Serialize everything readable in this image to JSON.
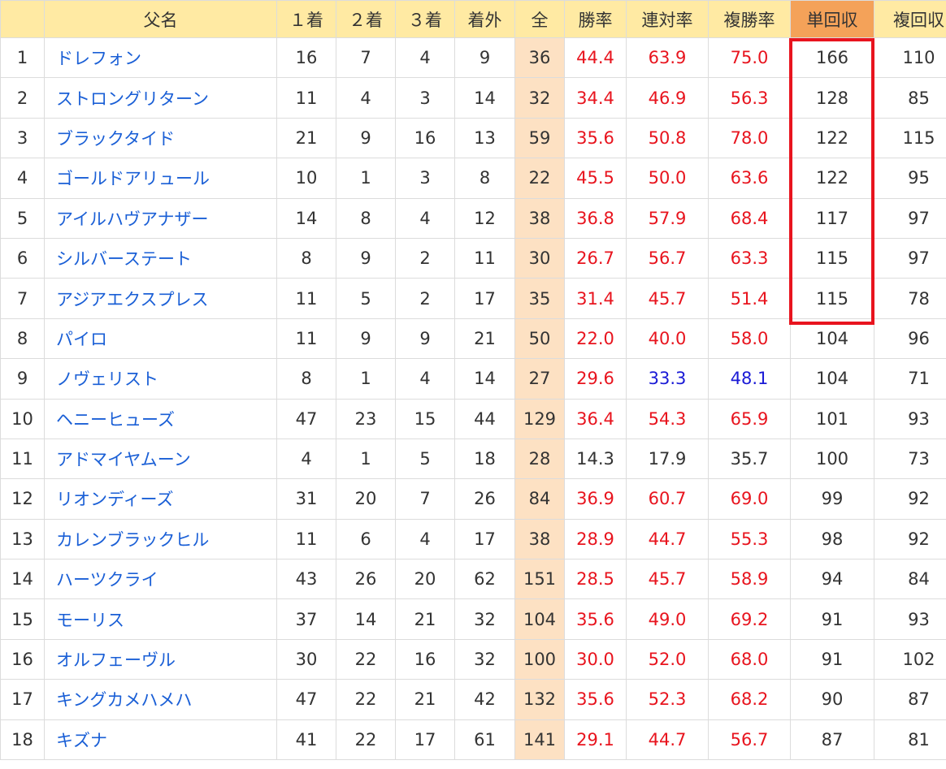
{
  "headers": [
    "",
    "父名",
    "１着",
    "２着",
    "３着",
    "着外",
    "全",
    "勝率",
    "連対率",
    "複勝率",
    "単回収",
    "複回収"
  ],
  "rows": [
    {
      "rank": "1",
      "name": "ドレフォン",
      "w1": "16",
      "w2": "7",
      "w3": "4",
      "out": "9",
      "total": "36",
      "win": "44.4",
      "rentai": "63.9",
      "fuku": "75.0",
      "tan": "166",
      "fukukai": "110"
    },
    {
      "rank": "2",
      "name": "ストロングリターン",
      "w1": "11",
      "w2": "4",
      "w3": "3",
      "out": "14",
      "total": "32",
      "win": "34.4",
      "rentai": "46.9",
      "fuku": "56.3",
      "tan": "128",
      "fukukai": "85"
    },
    {
      "rank": "3",
      "name": "ブラックタイド",
      "w1": "21",
      "w2": "9",
      "w3": "16",
      "out": "13",
      "total": "59",
      "win": "35.6",
      "rentai": "50.8",
      "fuku": "78.0",
      "tan": "122",
      "fukukai": "115"
    },
    {
      "rank": "4",
      "name": "ゴールドアリュール",
      "w1": "10",
      "w2": "1",
      "w3": "3",
      "out": "8",
      "total": "22",
      "win": "45.5",
      "rentai": "50.0",
      "fuku": "63.6",
      "tan": "122",
      "fukukai": "95"
    },
    {
      "rank": "5",
      "name": "アイルハヴアナザー",
      "w1": "14",
      "w2": "8",
      "w3": "4",
      "out": "12",
      "total": "38",
      "win": "36.8",
      "rentai": "57.9",
      "fuku": "68.4",
      "tan": "117",
      "fukukai": "97"
    },
    {
      "rank": "6",
      "name": "シルバーステート",
      "w1": "8",
      "w2": "9",
      "w3": "2",
      "out": "11",
      "total": "30",
      "win": "26.7",
      "rentai": "56.7",
      "fuku": "63.3",
      "tan": "115",
      "fukukai": "97"
    },
    {
      "rank": "7",
      "name": "アジアエクスプレス",
      "w1": "11",
      "w2": "5",
      "w3": "2",
      "out": "17",
      "total": "35",
      "win": "31.4",
      "rentai": "45.7",
      "fuku": "51.4",
      "tan": "115",
      "fukukai": "78"
    },
    {
      "rank": "8",
      "name": "パイロ",
      "w1": "11",
      "w2": "9",
      "w3": "9",
      "out": "21",
      "total": "50",
      "win": "22.0",
      "rentai": "40.0",
      "fuku": "58.0",
      "tan": "104",
      "fukukai": "96"
    },
    {
      "rank": "9",
      "name": "ノヴェリスト",
      "w1": "8",
      "w2": "1",
      "w3": "4",
      "out": "14",
      "total": "27",
      "win": "29.6",
      "rentai": "33.3",
      "fuku": "48.1",
      "tan": "104",
      "fukukai": "71"
    },
    {
      "rank": "10",
      "name": "ヘニーヒューズ",
      "w1": "47",
      "w2": "23",
      "w3": "15",
      "out": "44",
      "total": "129",
      "win": "36.4",
      "rentai": "54.3",
      "fuku": "65.9",
      "tan": "101",
      "fukukai": "93"
    },
    {
      "rank": "11",
      "name": "アドマイヤムーン",
      "w1": "4",
      "w2": "1",
      "w3": "5",
      "out": "18",
      "total": "28",
      "win": "14.3",
      "rentai": "17.9",
      "fuku": "35.7",
      "tan": "100",
      "fukukai": "73"
    },
    {
      "rank": "12",
      "name": "リオンディーズ",
      "w1": "31",
      "w2": "20",
      "w3": "7",
      "out": "26",
      "total": "84",
      "win": "36.9",
      "rentai": "60.7",
      "fuku": "69.0",
      "tan": "99",
      "fukukai": "92"
    },
    {
      "rank": "13",
      "name": "カレンブラックヒル",
      "w1": "11",
      "w2": "6",
      "w3": "4",
      "out": "17",
      "total": "38",
      "win": "28.9",
      "rentai": "44.7",
      "fuku": "55.3",
      "tan": "98",
      "fukukai": "92"
    },
    {
      "rank": "14",
      "name": "ハーツクライ",
      "w1": "43",
      "w2": "26",
      "w3": "20",
      "out": "62",
      "total": "151",
      "win": "28.5",
      "rentai": "45.7",
      "fuku": "58.9",
      "tan": "94",
      "fukukai": "84"
    },
    {
      "rank": "15",
      "name": "モーリス",
      "w1": "37",
      "w2": "14",
      "w3": "21",
      "out": "32",
      "total": "104",
      "win": "35.6",
      "rentai": "49.0",
      "fuku": "69.2",
      "tan": "91",
      "fukukai": "93"
    },
    {
      "rank": "16",
      "name": "オルフェーヴル",
      "w1": "30",
      "w2": "22",
      "w3": "16",
      "out": "32",
      "total": "100",
      "win": "30.0",
      "rentai": "52.0",
      "fuku": "68.0",
      "tan": "91",
      "fukukai": "102"
    },
    {
      "rank": "17",
      "name": "キングカメハメハ",
      "w1": "47",
      "w2": "22",
      "w3": "21",
      "out": "42",
      "total": "132",
      "win": "35.6",
      "rentai": "52.3",
      "fuku": "68.2",
      "tan": "90",
      "fukukai": "87"
    },
    {
      "rank": "18",
      "name": "キズナ",
      "w1": "41",
      "w2": "22",
      "w3": "17",
      "out": "61",
      "total": "141",
      "win": "29.1",
      "rentai": "44.7",
      "fuku": "56.7",
      "tan": "87",
      "fukukai": "81"
    }
  ],
  "colors": {
    "high": "#e8141e",
    "low": "#1a1ad6",
    "normal": "#333333",
    "name": "#1a5fd6",
    "highlight": "#e8141e",
    "total_bg": "#fde1c3",
    "header_bg": "#ffeaa3",
    "active_header_bg": "#f4a259"
  },
  "thresholds": {
    "win": 20.0,
    "rentai": 40.0,
    "fuku": 50.0
  }
}
